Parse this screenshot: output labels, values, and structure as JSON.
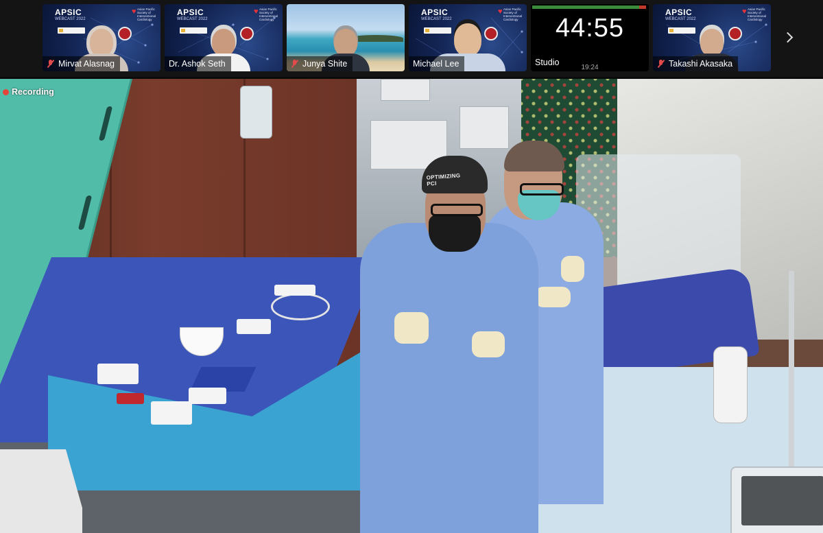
{
  "participants": [
    {
      "name": "Mirvat Alasnag",
      "muted": true,
      "brand": "APSIC",
      "brand_sub": "WEBCAST 2022",
      "society": "Asian Pacific Society of Interventional Cardiology",
      "badge": "OPTIMIZING"
    },
    {
      "name": "Dr. Ashok Seth",
      "muted": false,
      "brand": "APSIC",
      "brand_sub": "WEBCAST 2022",
      "society": "Asian Pacific Society of Interventional Cardiology",
      "badge": "OPTIMIZING"
    },
    {
      "name": "Junya Shite",
      "muted": true
    },
    {
      "name": "Michael Lee",
      "muted": false,
      "brand": "APSIC",
      "brand_sub": "WEBCAST 2022",
      "society": "Asian Pacific Society of Interventional Cardiology",
      "badge": "OPTIMIZING"
    },
    {
      "name": "Studio",
      "timer": "44:55",
      "clock": "19:24"
    },
    {
      "name": "Takashi Akasaka",
      "muted": true,
      "brand": "APSIC",
      "brand_sub": "WEBCAST 2022",
      "society": "Asian Pacific Society of Interventional Cardiology",
      "badge": "OPTIMIZING"
    }
  ],
  "main_video": {
    "recording_label": "Recording",
    "cap_text": "OPTIMIZING PCI"
  },
  "colors": {
    "recording_dot": "#e5443a",
    "muted_mic": "#e34b4b",
    "tile_bg": "#142656"
  },
  "icons": {
    "next": "chevron-right-icon",
    "muted": "mic-muted-icon"
  }
}
